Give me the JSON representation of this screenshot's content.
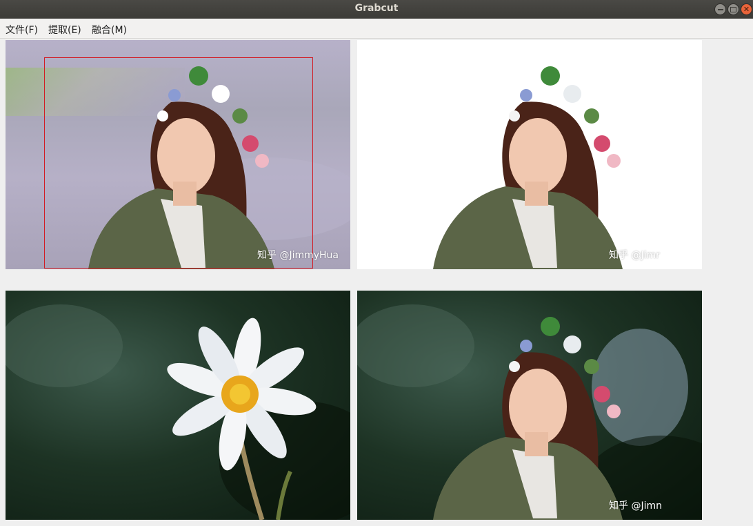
{
  "window": {
    "title": "Grabcut"
  },
  "menubar": {
    "items": [
      {
        "label": "文件(F)"
      },
      {
        "label": "提取(E)"
      },
      {
        "label": "融合(M)"
      }
    ]
  },
  "panels": {
    "original": {
      "watermark": "知乎 @JimmyHua"
    },
    "extracted": {
      "watermark": "知乎 @Jimr"
    },
    "background": {},
    "fused": {
      "watermark": "知乎 @Jimn"
    }
  },
  "colors": {
    "titlebar": "#3c3b37",
    "close_button": "#e9643a",
    "selection_rect": "#d21c24",
    "window_bg": "#efefef"
  },
  "icons": {
    "minimize": "minimize-icon",
    "maximize": "maximize-icon",
    "close": "close-icon"
  }
}
